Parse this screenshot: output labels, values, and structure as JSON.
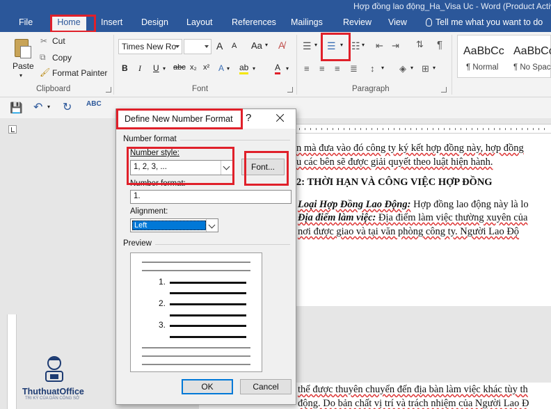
{
  "window": {
    "title": "Hợp đồng lao động_Ha_Visa Uc - Word (Product Activ"
  },
  "tabs": [
    "File",
    "Home",
    "Insert",
    "Design",
    "Layout",
    "References",
    "Mailings",
    "Review",
    "View"
  ],
  "active_tab": "Home",
  "tell_me": "Tell me what you want to do",
  "clipboard": {
    "paste": "Paste",
    "cut": "Cut",
    "copy": "Copy",
    "format_painter": "Format Painter",
    "label": "Clipboard"
  },
  "font": {
    "name": "Times New Ro",
    "size": "",
    "label": "Font",
    "bold": "B",
    "italic": "I",
    "underline": "U",
    "strike": "abc",
    "sub": "x₂",
    "sup": "x²",
    "grow": "A",
    "shrink": "A",
    "case": "Aa",
    "color_letter": "A"
  },
  "paragraph": {
    "label": "Paragraph",
    "pilcrow": "¶"
  },
  "styles": [
    {
      "preview": "AaBbCc",
      "name": "¶ Normal"
    },
    {
      "preview": "AaBbCc",
      "name": "¶ No Spac..."
    }
  ],
  "document": {
    "lines": [
      "n mà đưa vào đó công ty ký kết hợp đồng này, hợp đồng",
      "u các bên sẽ được giải quyết theo luật hiện hành.",
      "2: THỜI HẠN VÀ CÔNG VIỆC HỢP ĐỒNG",
      "Loại Hợp Đồng Lao Động:",
      " Hợp đồng lao động này là lo",
      "Địa điểm làm việc:",
      " Địa điểm làm việc thường xuyên của",
      "nơi được giao và tại văn phòng công ty. Người Lao Độ",
      "thể được thuyên chuyển đến địa bàn làm việc khác tùy th",
      "động. Do bản chất vị trí và trách nhiệm của Người Lao Đ"
    ]
  },
  "dialog": {
    "title": "Define New Number Format",
    "help": "?",
    "section_number_format": "Number format",
    "number_style_label": "Number style:",
    "number_style_value": "1, 2, 3, ...",
    "font_button": "Font...",
    "number_format_label": "Number format:",
    "number_format_value": "1.",
    "alignment_label": "Alignment:",
    "alignment_value": "Left",
    "preview_label": "Preview",
    "preview_numbers": [
      "1.",
      "2.",
      "3."
    ],
    "ok": "OK",
    "cancel": "Cancel"
  },
  "logo": {
    "text": "ThuthuatOffice",
    "tagline": "TRI KỲ CỦA DÂN CÔNG SỞ"
  },
  "colors": {
    "ribbon_blue": "#2b579a",
    "highlight_red": "#e0202a",
    "font_color_red": "#e0202a",
    "highlight_yellow": "#f5e600"
  }
}
